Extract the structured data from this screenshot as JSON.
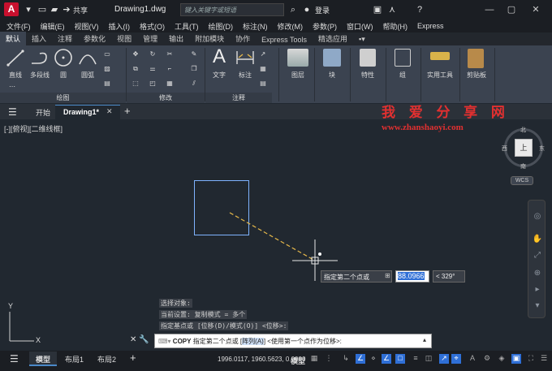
{
  "title_bar": {
    "logo": "A",
    "share_label": "共享",
    "doc_title": "Drawing1.dwg",
    "search_placeholder": "键入关键字或短语",
    "login_label": "登录"
  },
  "menu": [
    "文件(F)",
    "编辑(E)",
    "视图(V)",
    "插入(I)",
    "格式(O)",
    "工具(T)",
    "绘图(D)",
    "标注(N)",
    "修改(M)",
    "参数(P)",
    "窗口(W)",
    "帮助(H)",
    "Express"
  ],
  "ribbon_tabs": [
    "默认",
    "插入",
    "注释",
    "参数化",
    "视图",
    "管理",
    "输出",
    "附加模块",
    "协作",
    "Express Tools",
    "精选应用"
  ],
  "active_ribbon_tab": "默认",
  "ribbon": {
    "draw_tools": [
      "直线",
      "多段线",
      "圆",
      "圆弧"
    ],
    "draw_panel": "绘图",
    "modify_panel": "修改",
    "annotate_tools": [
      "文字",
      "标注"
    ],
    "annotate_panel": "注释",
    "big_tools": [
      "图层",
      "块",
      "特性",
      "组",
      "实用工具",
      "剪贴板"
    ]
  },
  "file_tabs": {
    "start": "开始",
    "drawing": "Drawing1*"
  },
  "viewport_label": "[-][俯视][二维线框]",
  "watermark": {
    "title": "我 爱 分 享 网",
    "url": "www.zhanshaoyi.com"
  },
  "dynamic_input": {
    "prompt": "指定第二个点或",
    "distance": "88.0966",
    "angle": "< 329°"
  },
  "command_history": [
    "选择对象:",
    "当前设置:  复制模式 = 多个",
    "指定基点或 [位移(D)/模式(O)] <位移>:"
  ],
  "command_line": {
    "cmd": "COPY",
    "text_before": "指定第二个点或 [",
    "option": "阵列(A)",
    "text_after": "] <使用第一个点作为位移>:"
  },
  "viewcube": {
    "north": "北",
    "south": "南",
    "west": "西",
    "east": "东",
    "center": "上",
    "wcs": "WCS"
  },
  "layout_tabs": [
    "模型",
    "布局1",
    "布局2"
  ],
  "status": {
    "coords": "1996.0117, 1960.5623, 0.0000",
    "space": "模型"
  },
  "axis_labels": {
    "x": "X",
    "y": "Y"
  },
  "colors": {
    "accent": "#2f6fd6",
    "rect": "#7fb3ff",
    "rubber_band": "#e6b84a",
    "watermark": "#e23030"
  }
}
